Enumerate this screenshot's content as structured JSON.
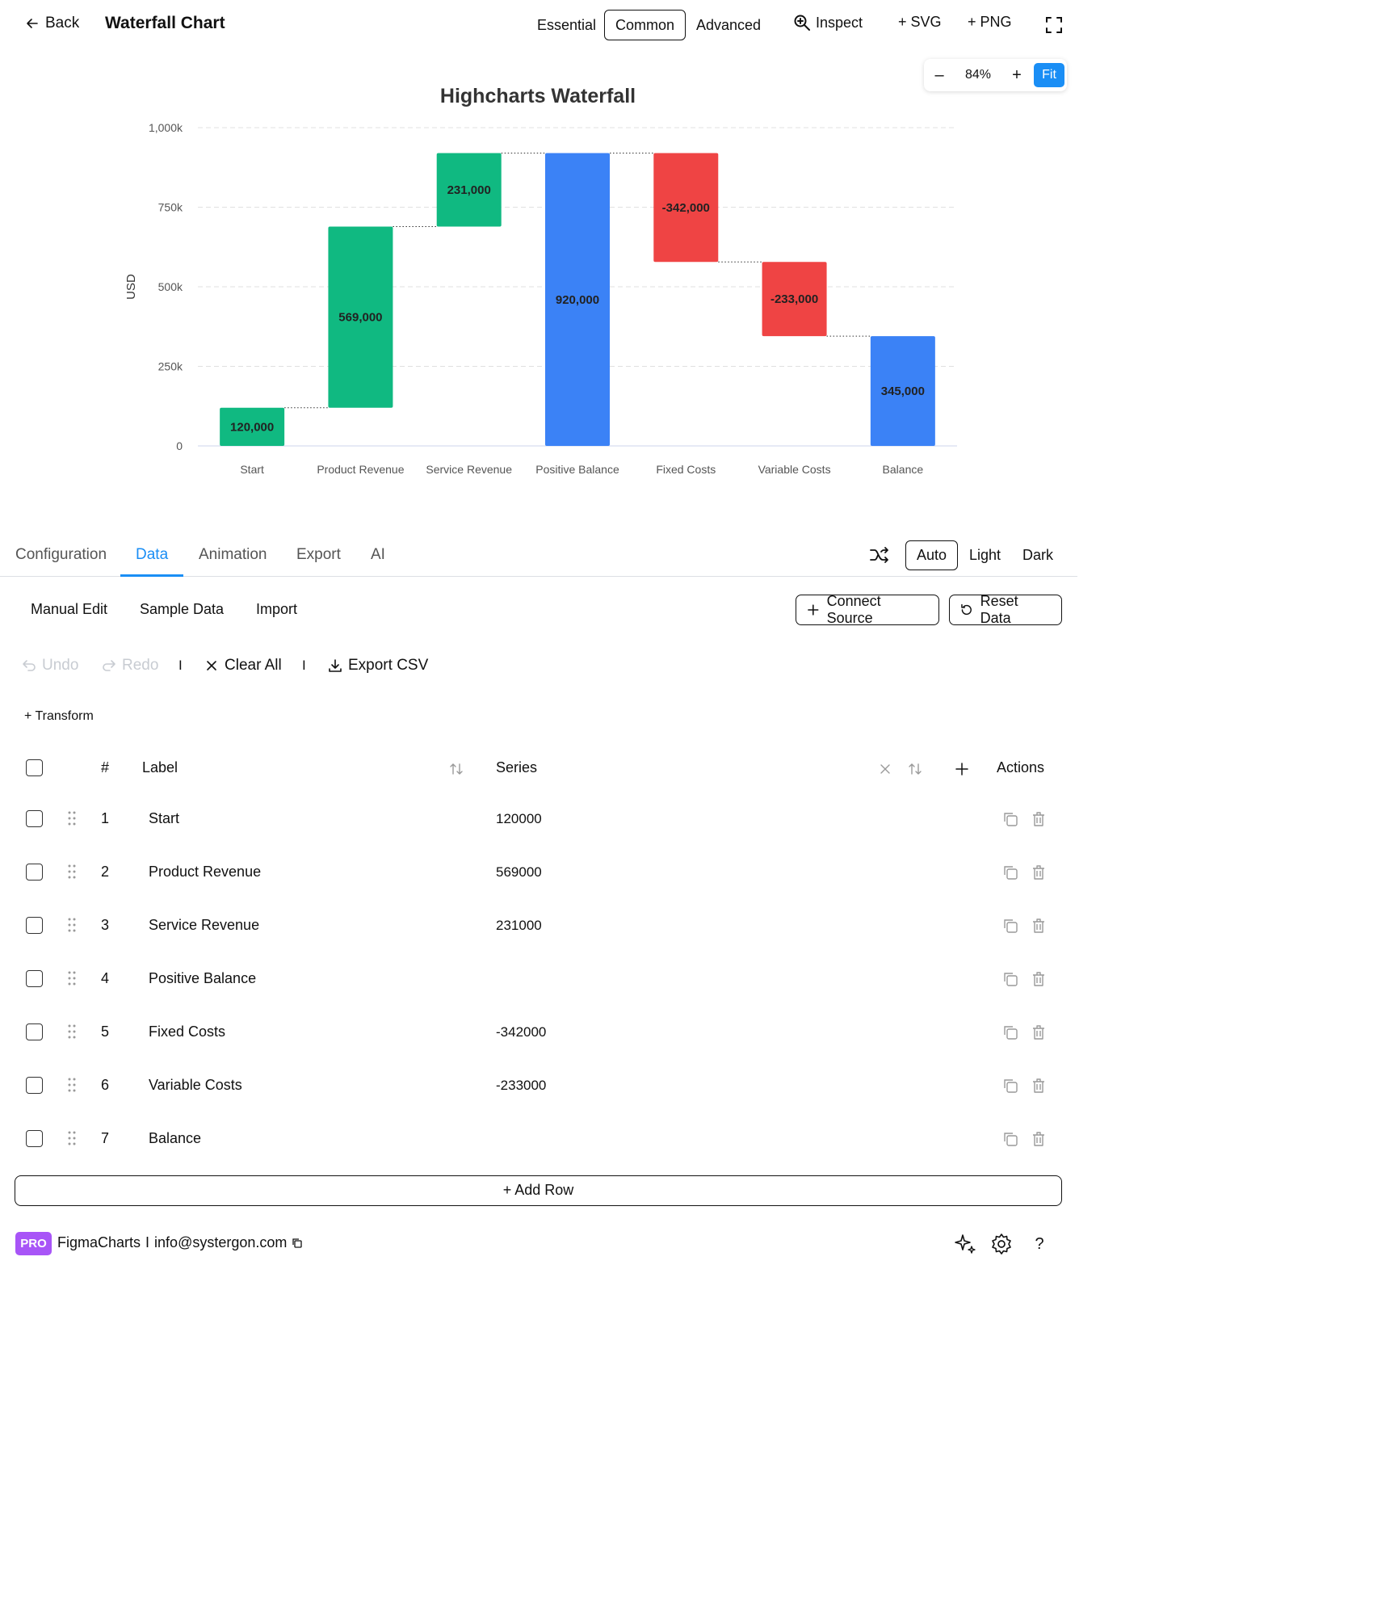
{
  "header": {
    "back_label": "Back",
    "title": "Waterfall Chart",
    "levels": [
      "Essential",
      "Common",
      "Advanced"
    ],
    "active_level": "Common",
    "inspect_label": "Inspect",
    "svg_label": "+ SVG",
    "png_label": "+ PNG"
  },
  "zoom": {
    "minus": "–",
    "value": "84%",
    "plus": "+",
    "fit": "Fit"
  },
  "chart_data": {
    "type": "waterfall",
    "title": "Highcharts Waterfall",
    "ylabel": "USD",
    "ylim": [
      0,
      1000000
    ],
    "yticks": [
      0,
      250000,
      500000,
      750000,
      1000000
    ],
    "ytick_labels": [
      "0",
      "250k",
      "500k",
      "750k",
      "1,000k"
    ],
    "categories": [
      "Start",
      "Product Revenue",
      "Service Revenue",
      "Positive Balance",
      "Fixed Costs",
      "Variable Costs",
      "Balance"
    ],
    "values": [
      120000,
      569000,
      231000,
      920000,
      -342000,
      -233000,
      345000
    ],
    "data_labels": [
      "120,000",
      "569,000",
      "231,000",
      "920,000",
      "-342,000",
      "-233,000",
      "345,000"
    ],
    "kinds": [
      "increase",
      "increase",
      "increase",
      "sum",
      "decrease",
      "decrease",
      "sum"
    ],
    "colors": {
      "increase": "#10b981",
      "decrease": "#ef4444",
      "sum": "#3b82f6"
    },
    "grid": true
  },
  "tabs": {
    "items": [
      "Configuration",
      "Data",
      "Animation",
      "Export",
      "AI"
    ],
    "active": "Data",
    "themes": [
      "Auto",
      "Light",
      "Dark"
    ],
    "active_theme": "Auto"
  },
  "data_panel": {
    "subtabs": [
      "Manual Edit",
      "Sample Data",
      "Import"
    ],
    "connect_source": "Connect Source",
    "reset_data": "Reset Data",
    "undo": "Undo",
    "redo": "Redo",
    "separator": "I",
    "clear_all": "Clear All",
    "export_csv": "Export CSV",
    "transform": "+ Transform"
  },
  "table": {
    "headers": {
      "num": "#",
      "label": "Label",
      "series": "Series",
      "actions": "Actions"
    },
    "rows": [
      {
        "num": "1",
        "label": "Start",
        "value": "120000"
      },
      {
        "num": "2",
        "label": "Product Revenue",
        "value": "569000"
      },
      {
        "num": "3",
        "label": "Service Revenue",
        "value": "231000"
      },
      {
        "num": "4",
        "label": "Positive Balance",
        "value": ""
      },
      {
        "num": "5",
        "label": "Fixed Costs",
        "value": "-342000"
      },
      {
        "num": "6",
        "label": "Variable Costs",
        "value": "-233000"
      },
      {
        "num": "7",
        "label": "Balance",
        "value": ""
      }
    ],
    "add_row": "+ Add Row"
  },
  "footer": {
    "badge": "PRO",
    "brand": "FigmaCharts",
    "separator": "I",
    "email": "info@systergon.com",
    "help": "?"
  }
}
